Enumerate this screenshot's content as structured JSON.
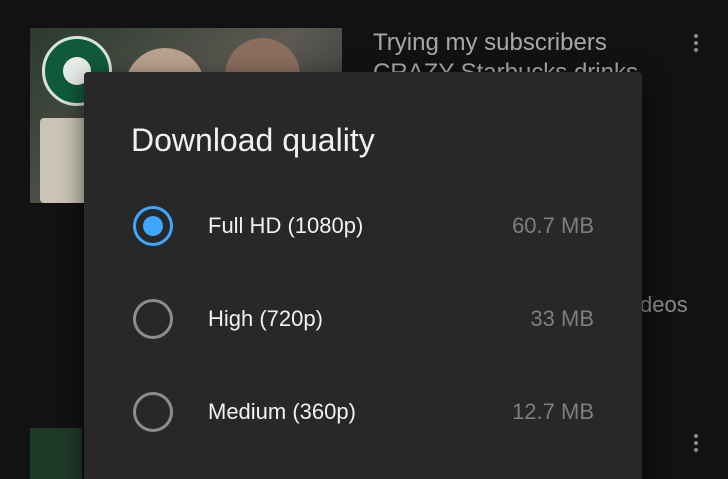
{
  "background": {
    "video_title_line1": "Trying my subscribers",
    "video_title_line2": "CRAZY Starbucks drinks",
    "fragment_text": "deos"
  },
  "dialog": {
    "title": "Download quality",
    "options": [
      {
        "label": "Full HD (1080p)",
        "size": "60.7 MB",
        "selected": true
      },
      {
        "label": "High (720p)",
        "size": "33 MB",
        "selected": false
      },
      {
        "label": "Medium (360p)",
        "size": "12.7 MB",
        "selected": false
      }
    ]
  },
  "colors": {
    "accent": "#3ea6ff",
    "dialog_bg": "#282828",
    "page_bg": "#0f0f0f"
  },
  "icons": {
    "more": "kebab-menu-icon",
    "radio": "radio-button-icon"
  }
}
